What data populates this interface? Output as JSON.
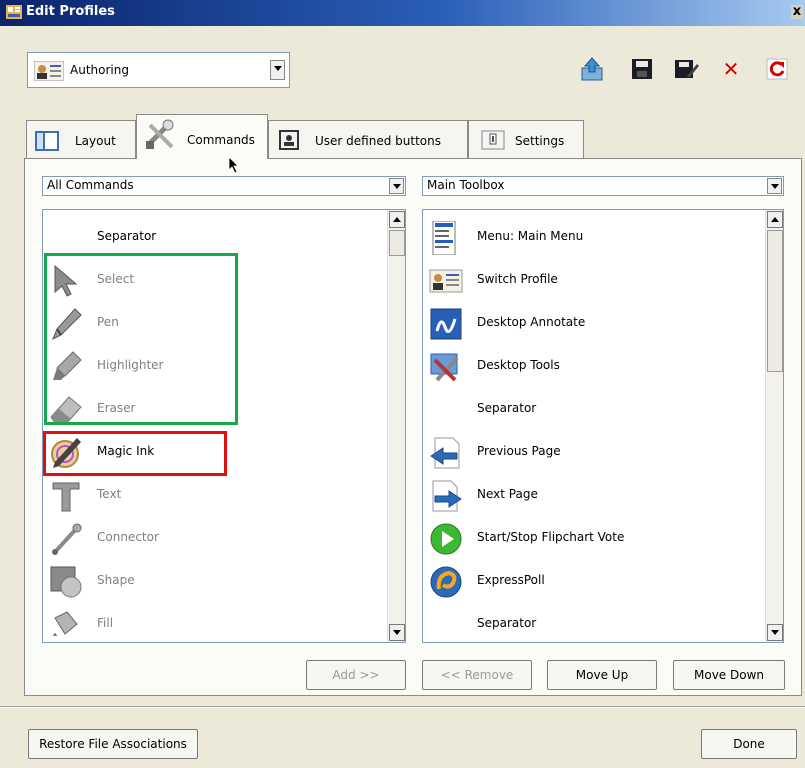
{
  "window": {
    "title": "Edit Profiles",
    "close_glyph": "x"
  },
  "profile": {
    "selected": "Authoring"
  },
  "toolbar": [
    {
      "name": "upload-icon"
    },
    {
      "name": "save-icon"
    },
    {
      "name": "save-edit-icon"
    },
    {
      "name": "delete-icon",
      "glyph": "✕",
      "color": "#d40000"
    },
    {
      "name": "reset-icon",
      "glyph": "↻",
      "color": "#d40000"
    }
  ],
  "tabs": [
    {
      "label": "Layout",
      "icon": "layout-icon"
    },
    {
      "label": "Commands",
      "icon": "tools-icon"
    },
    {
      "label": "User defined buttons",
      "icon": "user-icon"
    },
    {
      "label": "Settings",
      "icon": "settings-icon"
    }
  ],
  "left_filter": {
    "selected": "All Commands"
  },
  "right_filter": {
    "selected": "Main Toolbox"
  },
  "left_list": [
    {
      "label": "Separator",
      "icon": "none",
      "enabled": true
    },
    {
      "label": "Select",
      "icon": "cursor-icon",
      "enabled": false
    },
    {
      "label": "Pen",
      "icon": "pen-icon",
      "enabled": false
    },
    {
      "label": "Highlighter",
      "icon": "highlighter-icon",
      "enabled": false
    },
    {
      "label": "Eraser",
      "icon": "eraser-icon",
      "enabled": false
    },
    {
      "label": "Magic Ink",
      "icon": "magic-ink-icon",
      "enabled": true
    },
    {
      "label": "Text",
      "icon": "text-icon",
      "enabled": false
    },
    {
      "label": "Connector",
      "icon": "connector-icon",
      "enabled": false
    },
    {
      "label": "Shape",
      "icon": "shape-icon",
      "enabled": false
    },
    {
      "label": "Fill",
      "icon": "fill-icon",
      "enabled": false
    }
  ],
  "right_list": [
    {
      "label": "Menu: Main Menu",
      "icon": "menu-icon"
    },
    {
      "label": "Switch Profile",
      "icon": "profile-icon"
    },
    {
      "label": "Desktop Annotate",
      "icon": "annotate-icon"
    },
    {
      "label": "Desktop Tools",
      "icon": "desktop-tools-icon"
    },
    {
      "label": "Separator",
      "icon": "none"
    },
    {
      "label": "Previous Page",
      "icon": "previous-page-icon"
    },
    {
      "label": "Next Page",
      "icon": "next-page-icon"
    },
    {
      "label": "Start/Stop Flipchart Vote",
      "icon": "play-icon"
    },
    {
      "label": "ExpressPoll",
      "icon": "expresspoll-icon"
    },
    {
      "label": "Separator",
      "icon": "none"
    }
  ],
  "buttons": {
    "add": "Add >>",
    "remove": "<< Remove",
    "move_up": "Move Up",
    "move_down": "Move Down",
    "restore": "Restore File Associations",
    "done": "Done"
  },
  "colors": {
    "green_highlight": "#17a84a",
    "red_highlight": "#e01010"
  }
}
